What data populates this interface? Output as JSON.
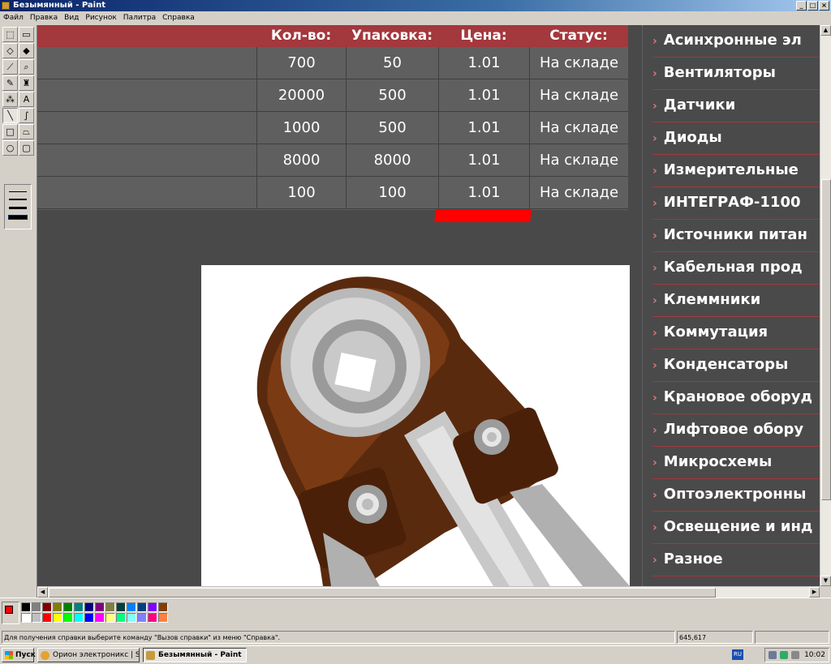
{
  "window": {
    "title": "Безымянный - Paint"
  },
  "menu": [
    "Файл",
    "Правка",
    "Вид",
    "Рисунок",
    "Палитра",
    "Справка"
  ],
  "tools": [
    {
      "name": "free-select-icon",
      "glyph": "⬚"
    },
    {
      "name": "rect-select-icon",
      "glyph": "▭"
    },
    {
      "name": "eraser-icon",
      "glyph": "◇"
    },
    {
      "name": "fill-icon",
      "glyph": "◆"
    },
    {
      "name": "picker-icon",
      "glyph": "⟋"
    },
    {
      "name": "magnifier-icon",
      "glyph": "⌕"
    },
    {
      "name": "pencil-icon",
      "glyph": "✎"
    },
    {
      "name": "brush-icon",
      "glyph": "♜"
    },
    {
      "name": "airbrush-icon",
      "glyph": "⁂"
    },
    {
      "name": "text-icon",
      "glyph": "A"
    },
    {
      "name": "line-icon",
      "glyph": "╲"
    },
    {
      "name": "curve-icon",
      "glyph": "∫"
    },
    {
      "name": "rectangle-icon",
      "glyph": "□"
    },
    {
      "name": "polygon-icon",
      "glyph": "⏢"
    },
    {
      "name": "ellipse-icon",
      "glyph": "○"
    },
    {
      "name": "rounded-rect-icon",
      "glyph": "▢"
    }
  ],
  "table": {
    "headers": [
      "Кол-во:",
      "Упаковка:",
      "Цена:",
      "Статус:"
    ],
    "rows": [
      [
        "700",
        "50",
        "1.01",
        "На складе"
      ],
      [
        "20000",
        "500",
        "1.01",
        "На складе"
      ],
      [
        "1000",
        "500",
        "1.01",
        "На складе"
      ],
      [
        "8000",
        "8000",
        "1.01",
        "На складе"
      ],
      [
        "100",
        "100",
        "1.01",
        "На складе"
      ]
    ]
  },
  "sidebar": [
    "Асинхронные эл",
    "Вентиляторы",
    "Датчики",
    "Диоды",
    "Измерительные",
    "ИНТЕГРАФ-1100",
    "Источники питан",
    "Кабельная прод",
    "Клеммники",
    "Коммутация",
    "Конденсаторы",
    "Крановое оборуд",
    "Лифтовое обору",
    "Микросхемы",
    "Оптоэлектронны",
    "Освещение и инд",
    "Разное"
  ],
  "palette": {
    "foreground": "#ff0000",
    "background": "#ffffff",
    "colors": [
      "#000000",
      "#808080",
      "#800000",
      "#808000",
      "#008000",
      "#008080",
      "#000080",
      "#800080",
      "#808040",
      "#004040",
      "#0080ff",
      "#004080",
      "#8000ff",
      "#804000",
      "#ffffff",
      "#c0c0c0",
      "#ff0000",
      "#ffff00",
      "#00ff00",
      "#00ffff",
      "#0000ff",
      "#ff00ff",
      "#ffff80",
      "#00ff80",
      "#80ffff",
      "#8080ff",
      "#ff0080",
      "#ff8040"
    ]
  },
  "status": {
    "help_text": "Для получения справки выберите команду \"Вызов справки\" из меню \"Справка\".",
    "coords": "645,617"
  },
  "taskbar": {
    "start": "Пуск",
    "tasks": [
      "Орион электроникс | S...",
      "Безымянный - Paint"
    ],
    "lang": "RU",
    "clock": "10:02"
  }
}
